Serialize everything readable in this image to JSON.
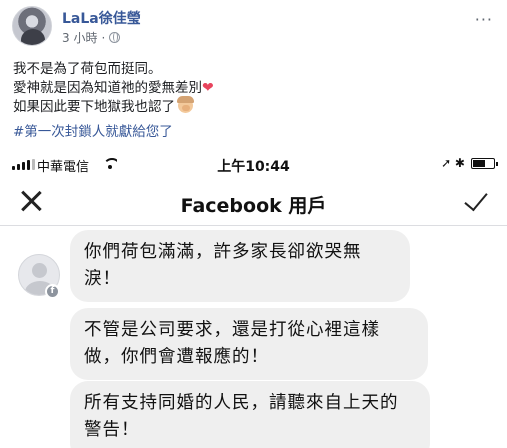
{
  "post": {
    "author": "LaLa徐佳瑩",
    "time": "3 小時",
    "more": "···",
    "lines": [
      "我不是為了荷包而挺同。",
      "愛神就是因為知道祂的愛無差別",
      "如果因此要下地獄我也認了"
    ],
    "heart_emoji": "❤",
    "hashtag": "#第一次封鎖人就獻給您了"
  },
  "phone": {
    "status": {
      "carrier": "中華電信",
      "time": "上午10:44",
      "icons": "➚ ✱"
    },
    "nav": {
      "title": "Facebook 用戶"
    },
    "messages": [
      "你們荷包滿滿，許多家長卻欲哭無淚！",
      "不管是公司要求，還是打從心裡這樣做，你們會遭報應的！",
      "所有支持同婚的人民，請聽來自上天的警告！"
    ],
    "badge": "f"
  }
}
